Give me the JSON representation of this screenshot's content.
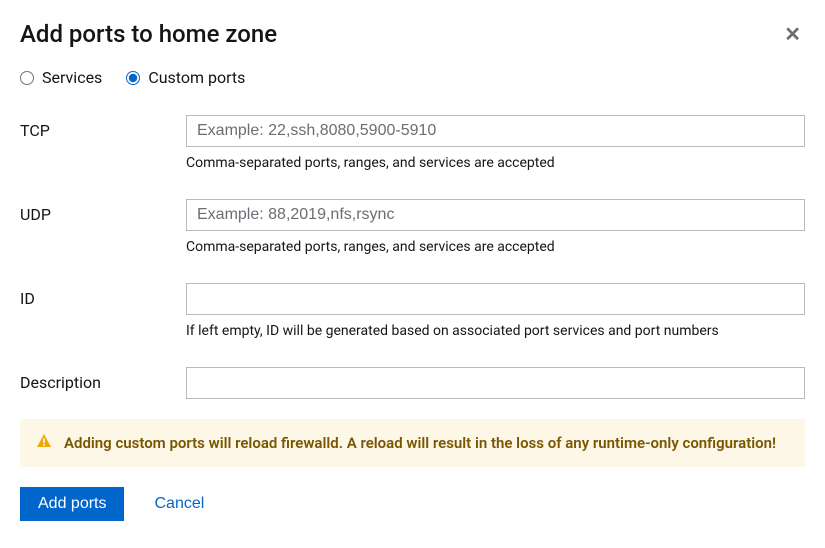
{
  "title": "Add ports to home zone",
  "radio": {
    "services_label": "Services",
    "custom_label": "Custom ports",
    "selected": "custom"
  },
  "fields": {
    "tcp": {
      "label": "TCP",
      "value": "",
      "placeholder": "Example: 22,ssh,8080,5900-5910",
      "help": "Comma-separated ports, ranges, and services are accepted"
    },
    "udp": {
      "label": "UDP",
      "value": "",
      "placeholder": "Example: 88,2019,nfs,rsync",
      "help": "Comma-separated ports, ranges, and services are accepted"
    },
    "id": {
      "label": "ID",
      "value": "",
      "placeholder": "",
      "help": "If left empty, ID will be generated based on associated port services and port numbers"
    },
    "description": {
      "label": "Description",
      "value": "",
      "placeholder": "",
      "help": ""
    }
  },
  "alert": {
    "text": "Adding custom ports will reload firewalld. A reload will result in the loss of any runtime-only configuration!"
  },
  "actions": {
    "primary": "Add ports",
    "cancel": "Cancel"
  }
}
